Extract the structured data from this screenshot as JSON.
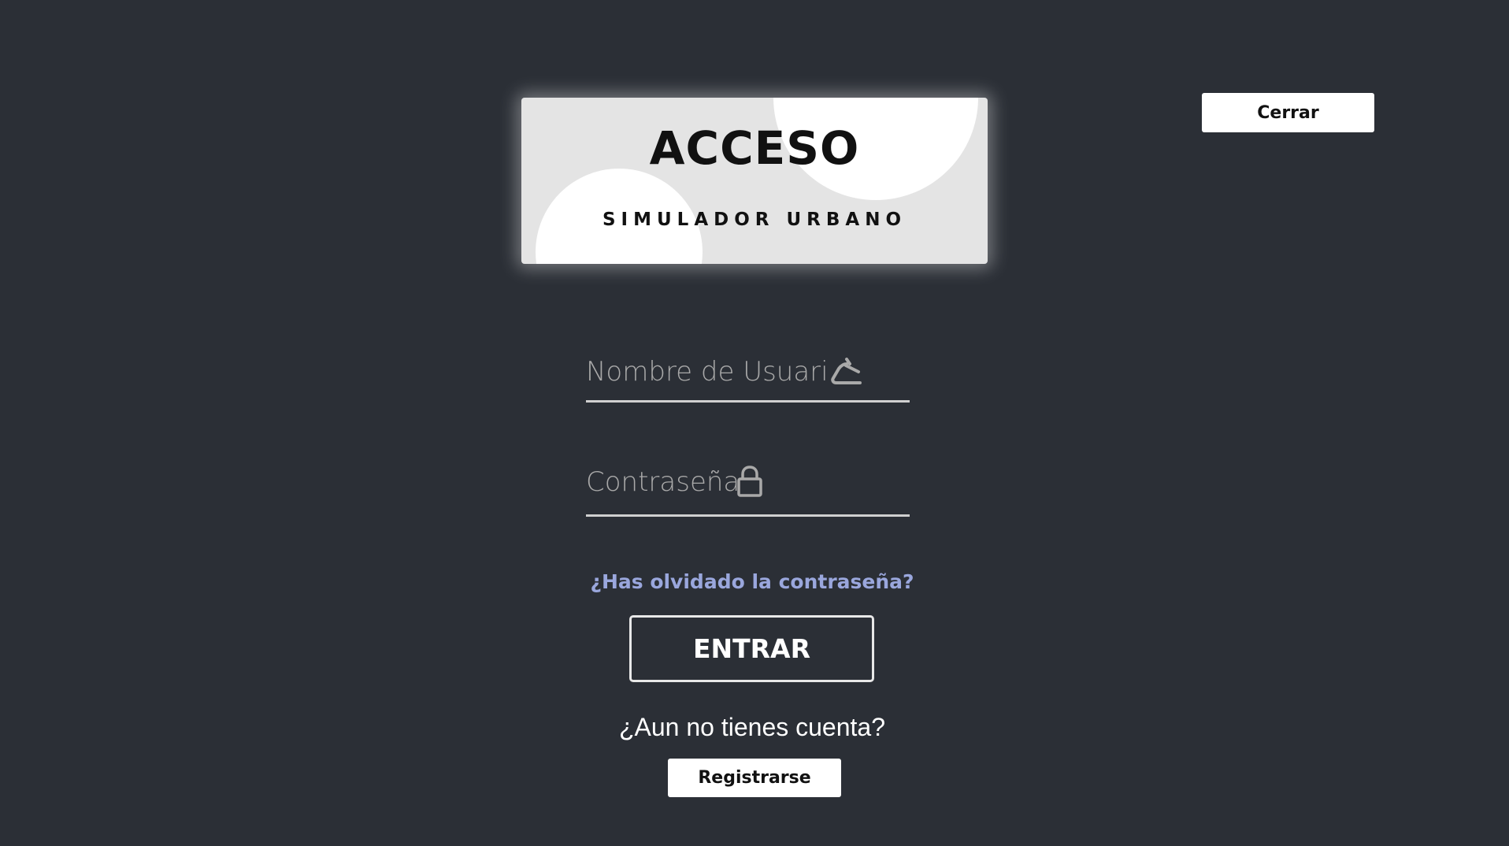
{
  "header": {
    "title": "ACCESO",
    "subtitle": "SIMULADOR URBANO"
  },
  "close_button": {
    "label": "Cerrar"
  },
  "username_field": {
    "placeholder": "Nombre de Usuario",
    "value": "",
    "icon": "hanger-icon"
  },
  "password_field": {
    "placeholder": "Contraseña",
    "value": "",
    "icon": "lock-icon"
  },
  "forgot_link": {
    "label": "¿Has olvidado la contraseña?"
  },
  "enter_button": {
    "label": "ENTRAR"
  },
  "no_account_text": "¿Aun no tienes cuenta?",
  "register_button": {
    "label": "Registrarse"
  },
  "colors": {
    "background": "#2b2f36",
    "card": "#e4e4e4",
    "link": "#9aa7dd",
    "underline": "#d0d0d0"
  }
}
